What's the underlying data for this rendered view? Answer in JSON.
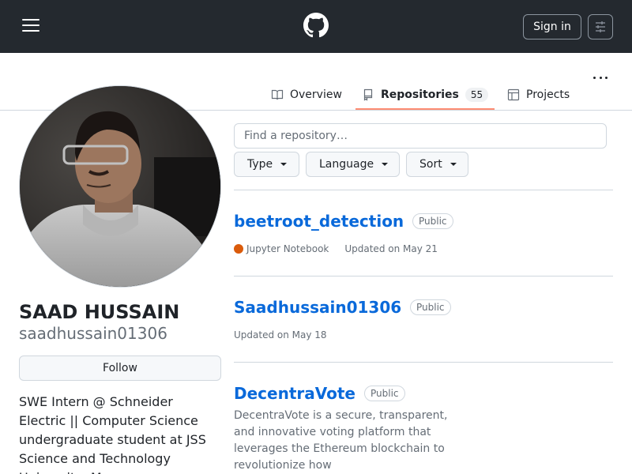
{
  "header": {
    "signin_label": "Sign in"
  },
  "tabs": [
    {
      "label": "Overview"
    },
    {
      "label": "Repositories",
      "count": "55"
    },
    {
      "label": "Projects"
    }
  ],
  "profile": {
    "full_name": "SAAD HUSSAIN",
    "login": "saadhussain01306",
    "follow_label": "Follow",
    "bio": "SWE Intern @ Schneider Electric || Computer Science undergraduate student at JSS Science and Technology University, My..."
  },
  "repo_search": {
    "placeholder": "Find a repository…"
  },
  "filters": [
    {
      "label": "Type"
    },
    {
      "label": "Language"
    },
    {
      "label": "Sort"
    }
  ],
  "repos": [
    {
      "name": "beetroot_detection",
      "visibility": "Public",
      "language": "Jupyter Notebook",
      "language_color": "#DA5B0B",
      "updated": "Updated on May 21"
    },
    {
      "name": "Saadhussain01306",
      "visibility": "Public",
      "updated": "Updated on May 18"
    },
    {
      "name": "DecentraVote",
      "visibility": "Public",
      "description": "DecentraVote is a secure, transparent, and innovative voting platform that leverages the Ethereum blockchain to revolutionize how"
    }
  ],
  "colors": {
    "header_bg": "#24292f",
    "link": "#0969da",
    "tab_underline": "#fd8c73"
  },
  "icons": [
    "hamburger-icon",
    "github-logo-icon",
    "search-settings-icon",
    "book-icon",
    "repo-icon",
    "table-icon",
    "kebab-icon"
  ]
}
